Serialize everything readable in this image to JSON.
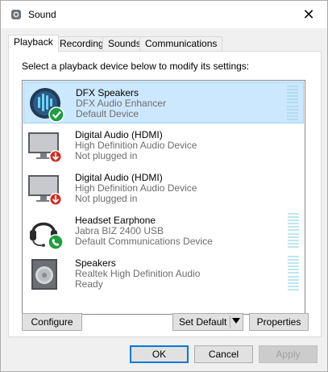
{
  "window": {
    "title": "Sound",
    "close_icon": "close-icon"
  },
  "tabs": [
    {
      "label": "Playback",
      "active": true
    },
    {
      "label": "Recording",
      "active": false
    },
    {
      "label": "Sounds",
      "active": false
    },
    {
      "label": "Communications",
      "active": false
    }
  ],
  "instruction": "Select a playback device below to modify its settings:",
  "devices": [
    {
      "name": "DFX Speakers",
      "subtitle": "DFX Audio Enhancer",
      "status": "Default Device",
      "icon": "dfx-speakers-icon",
      "badge": "check-badge-icon",
      "selected": true
    },
    {
      "name": "Digital Audio (HDMI)",
      "subtitle": "High Definition Audio Device",
      "status": "Not plugged in",
      "icon": "monitor-icon",
      "badge": "down-arrow-badge-icon",
      "selected": false
    },
    {
      "name": "Digital Audio (HDMI)",
      "subtitle": "High Definition Audio Device",
      "status": "Not plugged in",
      "icon": "monitor-icon",
      "badge": "down-arrow-badge-icon",
      "selected": false
    },
    {
      "name": "Headset Earphone",
      "subtitle": "Jabra BIZ 2400 USB",
      "status": "Default Communications Device",
      "icon": "headset-icon",
      "badge": "phone-badge-icon",
      "selected": false
    },
    {
      "name": "Speakers",
      "subtitle": "Realtek High Definition Audio",
      "status": "Ready",
      "icon": "speaker-icon",
      "badge": "",
      "selected": false
    }
  ],
  "buttons": {
    "configure": "Configure",
    "set_default": "Set Default",
    "properties": "Properties",
    "ok": "OK",
    "cancel": "Cancel",
    "apply": "Apply"
  },
  "colors": {
    "selection": "#cce8ff",
    "accent": "#0078d7",
    "badge_green": "#1e9e3e",
    "badge_red": "#d42a1f"
  }
}
